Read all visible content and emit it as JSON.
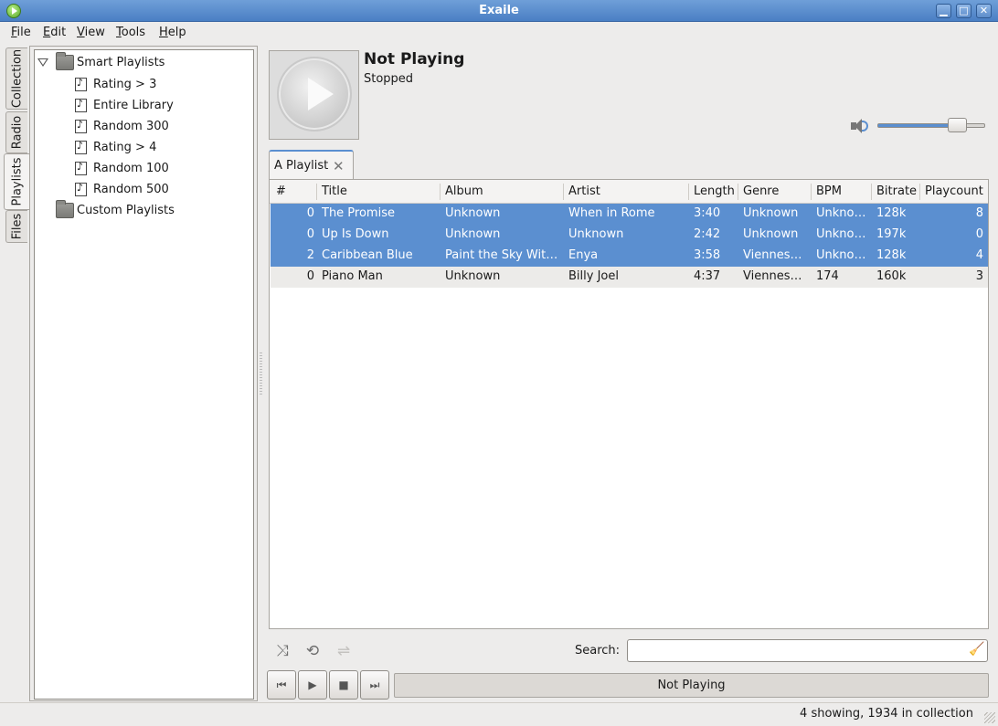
{
  "window": {
    "title": "Exaile",
    "buttons": [
      "minimize",
      "maximize",
      "close"
    ]
  },
  "menu": [
    {
      "label": "File",
      "key": "F",
      "rest": "ile"
    },
    {
      "label": "Edit",
      "key": "E",
      "rest": "dit"
    },
    {
      "label": "View",
      "key": "V",
      "rest": "iew"
    },
    {
      "label": "Tools",
      "key": "T",
      "rest": "ools"
    },
    {
      "label": "Help",
      "key": "H",
      "rest": "elp"
    }
  ],
  "side_tabs": [
    {
      "label": "Collection",
      "active": false
    },
    {
      "label": "Radio",
      "active": false
    },
    {
      "label": "Playlists",
      "active": true
    },
    {
      "label": "Files",
      "active": false
    }
  ],
  "tree": {
    "smart_playlists": "Smart Playlists",
    "smart_items": [
      "Rating > 3",
      "Entire Library",
      "Random 300",
      "Rating > 4",
      "Random 100",
      "Random 500"
    ],
    "custom_playlists": "Custom Playlists"
  },
  "now_playing": {
    "title": "Not Playing",
    "status": "Stopped"
  },
  "volume": {
    "level": 0.74
  },
  "playlist_tab": {
    "label": "A Playlist"
  },
  "columns": [
    "#",
    "Title",
    "Album",
    "Artist",
    "Length",
    "Genre",
    "BPM",
    "Bitrate",
    "Playcount"
  ],
  "rows": [
    {
      "num": "0",
      "title": "The Promise",
      "album": "Unknown",
      "artist": "When in Rome",
      "length": "3:40",
      "genre": "Unknown",
      "bpm": "Unknown",
      "bitrate": "128k",
      "playcount": "8",
      "selected": true
    },
    {
      "num": "0",
      "title": "Up Is Down",
      "album": "Unknown",
      "artist": "Unknown",
      "length": "2:42",
      "genre": "Unknown",
      "bpm": "Unknown",
      "bitrate": "197k",
      "playcount": "0",
      "selected": true
    },
    {
      "num": "2",
      "title": "Caribbean Blue",
      "album": "Paint the Sky Wit…",
      "artist": "Enya",
      "length": "3:58",
      "genre": "Viennese…",
      "bpm": "Unknown",
      "bitrate": "128k",
      "playcount": "4",
      "selected": true
    },
    {
      "num": "0",
      "title": "Piano Man",
      "album": "Unknown",
      "artist": "Billy Joel",
      "length": "4:37",
      "genre": "Viennese…",
      "bpm": "174",
      "bitrate": "160k",
      "playcount": "3",
      "selected": false
    }
  ],
  "search": {
    "label": "Search:",
    "value": ""
  },
  "transport": {
    "bar_label": "Not Playing"
  },
  "status": {
    "text": "4 showing, 1934 in collection"
  }
}
